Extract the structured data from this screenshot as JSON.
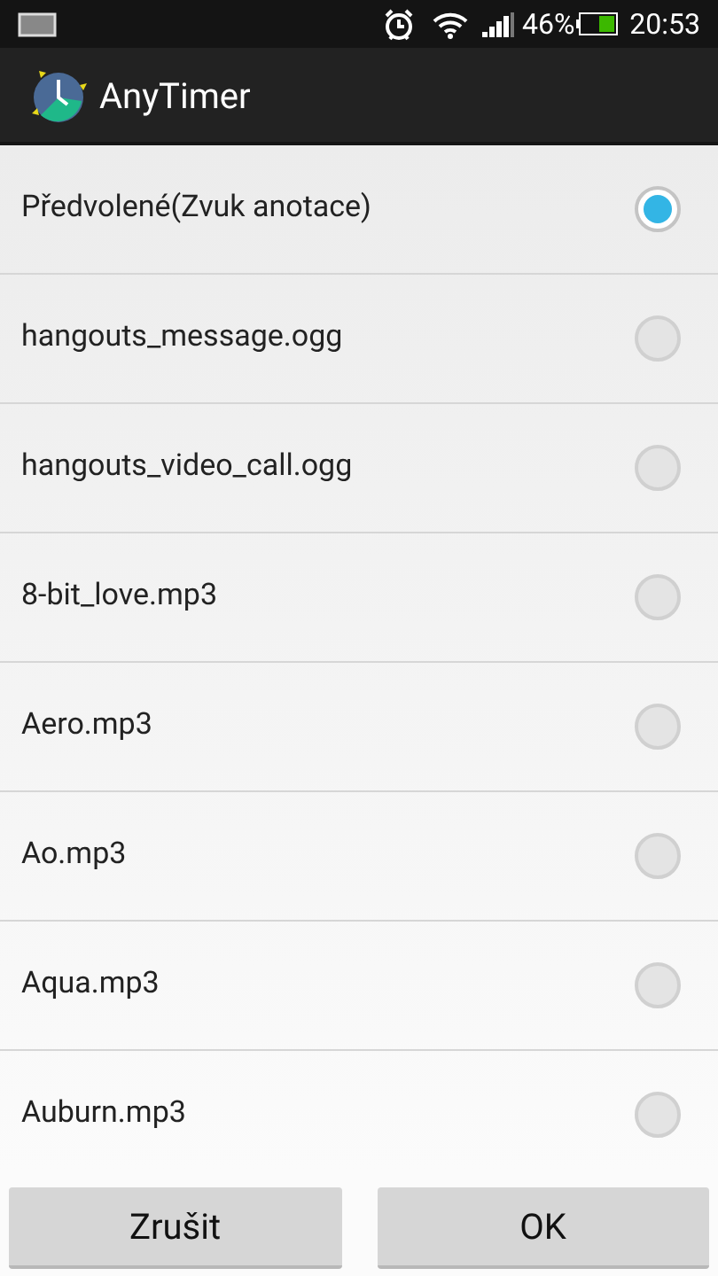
{
  "status_bar": {
    "battery": "46%",
    "time": "20:53"
  },
  "app_bar": {
    "title": "AnyTimer"
  },
  "options": [
    {
      "label": "Předvolené(Zvuk anotace)",
      "selected": true
    },
    {
      "label": "hangouts_message.ogg",
      "selected": false
    },
    {
      "label": "hangouts_video_call.ogg",
      "selected": false
    },
    {
      "label": "8-bit_love.mp3",
      "selected": false
    },
    {
      "label": "Aero.mp3",
      "selected": false
    },
    {
      "label": "Ao.mp3",
      "selected": false
    },
    {
      "label": "Aqua.mp3",
      "selected": false
    },
    {
      "label": "Auburn.mp3",
      "selected": false
    }
  ],
  "buttons": [
    "Zrušit",
    "OK"
  ]
}
